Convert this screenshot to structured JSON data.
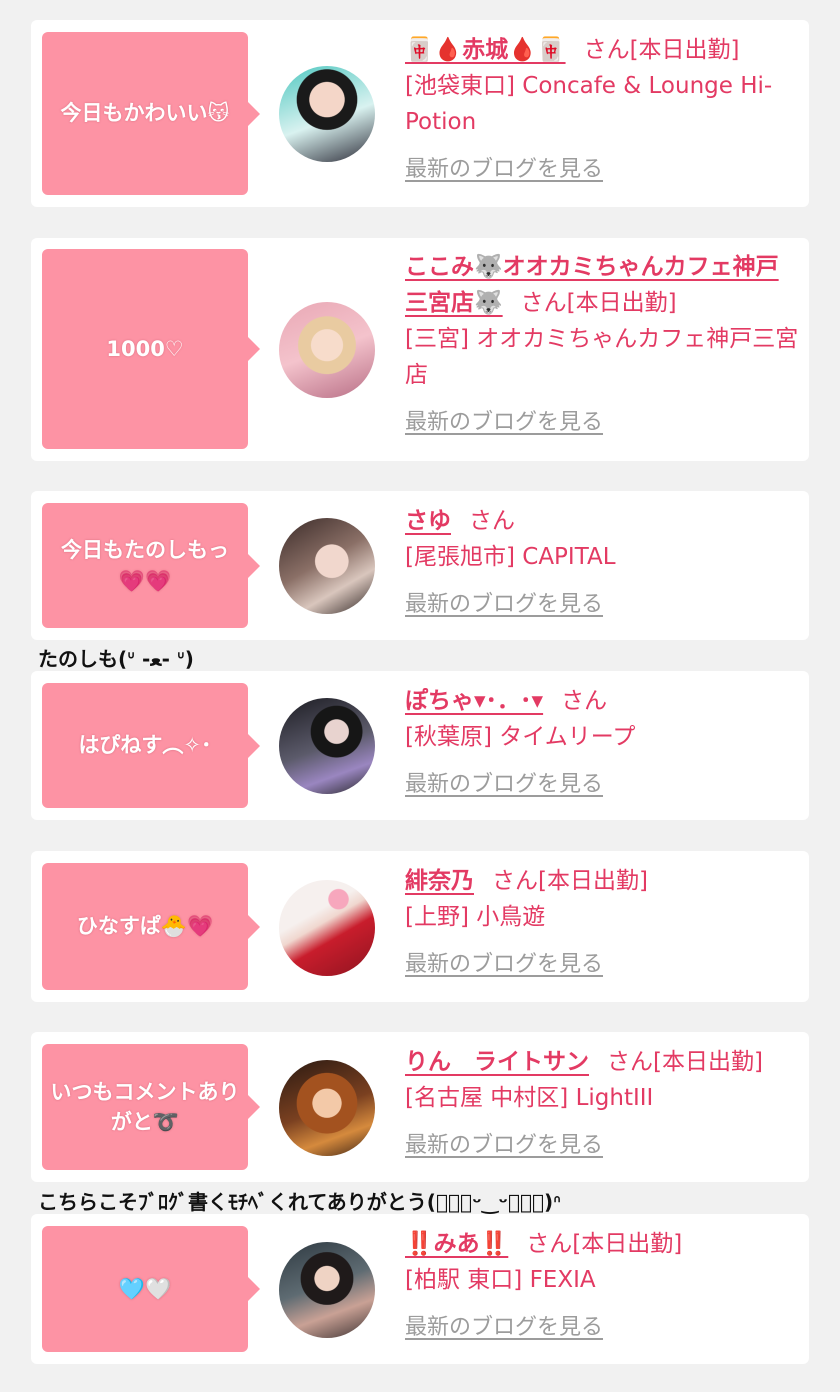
{
  "colors": {
    "accent": "#e33a63",
    "bubble": "#fd93a4",
    "link_gray": "#9c9c9c",
    "page_bg": "#f1f1f1"
  },
  "entries": [
    {
      "bubble": "今日もかわいい😽",
      "name": "🀄🩸赤城🩸🀄",
      "san": "さん",
      "status": "[本日出勤]",
      "shop": "[池袋東口] Concafe & Lounge Hi-Potion",
      "blog_link": "最新のブログを見る"
    },
    {
      "bubble": "1000♡",
      "name": "ここみ🐺オオカミちゃんカフェ神戸三宮店🐺",
      "san": "さん",
      "status": "[本日出勤]",
      "shop": "[三宮] オオカミちゃんカフェ神戸三宮店",
      "blog_link": "最新のブログを見る"
    },
    {
      "bubble": "今日もたのしもっ💗💗",
      "name": "さゆ",
      "san": "さん",
      "status": "",
      "shop": "[尾張旭市] CAPITAL",
      "blog_link": "最新のブログを見る"
    },
    {
      "bubble": "はぴねす︵✧･",
      "name": "ぽちゃ▾･．･▾",
      "san": "さん",
      "status": "",
      "shop": "[秋葉原] タイムリープ",
      "blog_link": "最新のブログを見る"
    },
    {
      "bubble": "ひなすぱ🐣💗",
      "name": "緋奈乃",
      "san": "さん",
      "status": "[本日出勤]",
      "shop": "[上野] 小鳥遊",
      "blog_link": "最新のブログを見る"
    },
    {
      "bubble": "いつもコメントありがと➰",
      "name": "りん　ライトサン",
      "san": "さん",
      "status": "[本日出勤]",
      "shop": "[名古屋 中村区] LightIII",
      "blog_link": "最新のブログを見る"
    },
    {
      "bubble": "🩵🤍",
      "name": "‼️みあ‼️",
      "san": "さん",
      "status": "[本日出勤]",
      "shop": "[柏駅 東口] FEXIA",
      "blog_link": "最新のブログを見る"
    }
  ],
  "comments": [
    "たのしも(ᐡ -ﻌ- ᐡ)",
    "こちらこそﾌﾞﾛｸﾞ書くﾓﾁﾍﾞくれてありがとう(๑⃙⃘ᵕ‿ᵕ๑⃙⃘)ᐢ"
  ]
}
